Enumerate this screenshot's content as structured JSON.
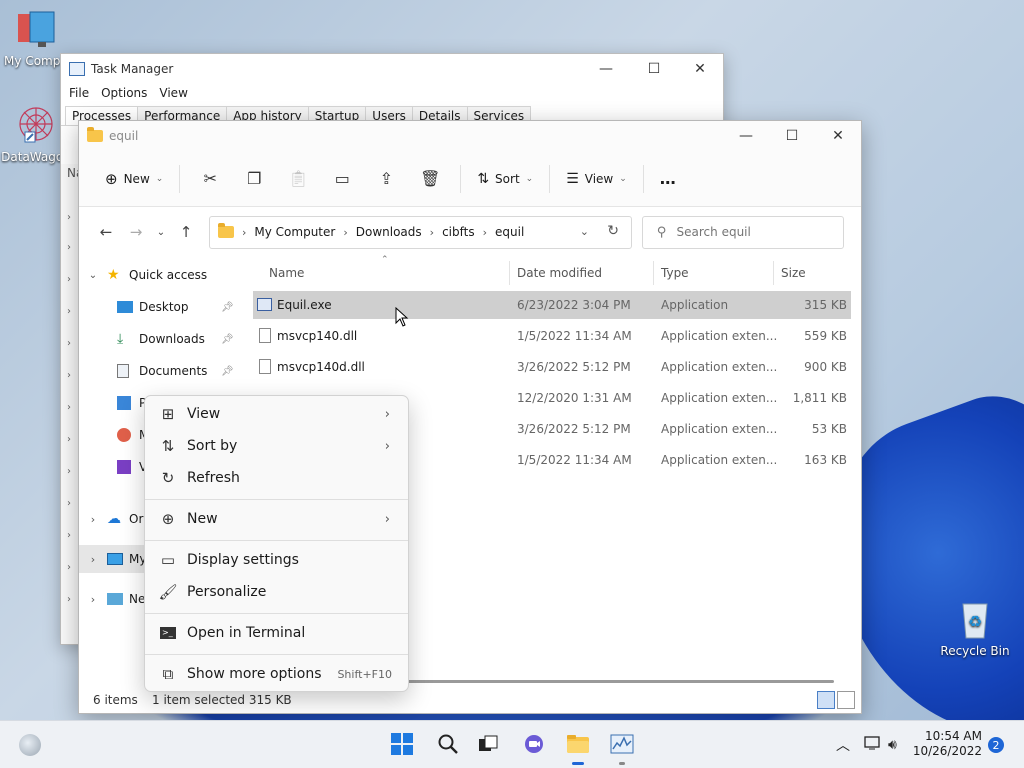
{
  "desktop": {
    "icons": [
      {
        "label": "My Compu",
        "icon": "my-computer-icon"
      },
      {
        "label": "DataWagon",
        "icon": "datawagon-icon"
      },
      {
        "label": "Recycle Bin",
        "icon": "recycle-bin-icon"
      }
    ]
  },
  "task_manager": {
    "title": "Task Manager",
    "menu": [
      "File",
      "Options",
      "View"
    ],
    "tabs": [
      "Processes",
      "Performance",
      "App history",
      "Startup",
      "Users",
      "Details",
      "Services"
    ],
    "partial_col": "Na"
  },
  "explorer": {
    "title": "equil",
    "toolbar": {
      "new_label": "New",
      "sort_label": "Sort",
      "view_label": "View",
      "more": "…"
    },
    "breadcrumb": [
      "My Computer",
      "Downloads",
      "cibfts",
      "equil"
    ],
    "search_placeholder": "Search equil",
    "nav": {
      "quick_access": "Quick access",
      "desktop": "Desktop",
      "downloads": "Downloads",
      "documents": "Documents",
      "pictures_partial": "P",
      "music_partial": "M",
      "videos_partial": "V",
      "onedrive_partial": "Or",
      "mycomputer_partial": "My",
      "network_partial": "Ne"
    },
    "columns": {
      "name": "Name",
      "date": "Date modified",
      "type": "Type",
      "size": "Size"
    },
    "files": [
      {
        "name": "Equil.exe",
        "date": "6/23/2022 3:04 PM",
        "type": "Application",
        "size": "315 KB"
      },
      {
        "name": "msvcp140.dll",
        "date": "1/5/2022 11:34 AM",
        "type": "Application exten...",
        "size": "559 KB"
      },
      {
        "name": "msvcp140d.dll",
        "date": "3/26/2022 5:12 PM",
        "type": "Application exten...",
        "size": "900 KB"
      },
      {
        "name": "",
        "date": "12/2/2020 1:31 AM",
        "type": "Application exten...",
        "size": "1,811 KB"
      },
      {
        "name": "",
        "date": "3/26/2022 5:12 PM",
        "type": "Application exten...",
        "size": "53 KB"
      },
      {
        "name": "",
        "date": "1/5/2022 11:34 AM",
        "type": "Application exten...",
        "size": "163 KB"
      }
    ],
    "status": {
      "count": "6 items",
      "selected": "1 item selected  315 KB"
    }
  },
  "context_menu": {
    "view": "View",
    "sort_by": "Sort by",
    "refresh": "Refresh",
    "new": "New",
    "display_settings": "Display settings",
    "personalize": "Personalize",
    "open_terminal": "Open in Terminal",
    "show_more": "Show more options",
    "show_more_accel": "Shift+F10"
  },
  "taskbar": {
    "time": "10:54 AM",
    "date": "10/26/2022",
    "notifications": "2"
  },
  "colors": {
    "accent": "#1e66d6",
    "selection": "#cfcfcf",
    "folder": "#f8c54a"
  }
}
